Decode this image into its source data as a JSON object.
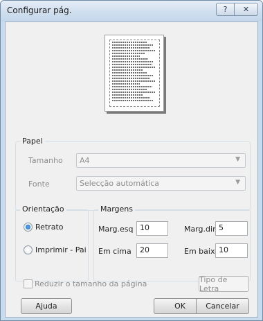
{
  "window": {
    "title": "Configurar pág.",
    "help_glyph": "?",
    "close_glyph": "✕"
  },
  "paper": {
    "group_label": "Papel",
    "size_label": "Tamanho",
    "size_value": "A4",
    "source_label": "Fonte",
    "source_value": "Selecção automática"
  },
  "orientation": {
    "group_label": "Orientação",
    "portrait_label": "Retrato",
    "portrait_checked": true,
    "landscape_label": "Imprimir - Pai",
    "landscape_checked": false
  },
  "margins": {
    "group_label": "Margens",
    "left_label": "Marg.esq",
    "left_value": "10",
    "right_label": "Marg.dire",
    "right_value": "5",
    "top_label": "Em cima",
    "top_value": "20",
    "bottom_label": "Em baixo",
    "bottom_value": "10"
  },
  "shrink": {
    "label": "Reduzir o tamanho da página",
    "checked": false
  },
  "buttons": {
    "font": "Tipo de Letra",
    "help": "Ajuda",
    "ok": "OK",
    "cancel": "Cancelar"
  },
  "icons": {
    "combo_arrow": "▼"
  }
}
